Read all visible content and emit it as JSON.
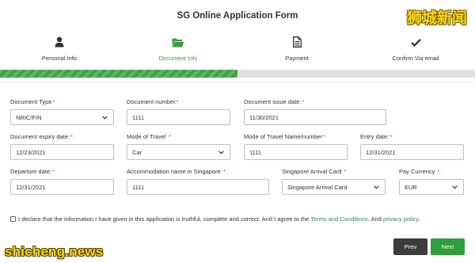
{
  "form": {
    "title": "SG Online Application Form"
  },
  "watermarks": {
    "top": "狮城新闻",
    "bottom": "shicheng.news"
  },
  "steps": [
    {
      "label": "Personal Info",
      "icon": "user-icon",
      "active": false
    },
    {
      "label": "Document Info",
      "icon": "folder-open-icon",
      "active": true
    },
    {
      "label": "Payment",
      "icon": "document-icon",
      "active": false
    },
    {
      "label": "Confirm Via email",
      "icon": "check-icon",
      "active": false
    }
  ],
  "progress": {
    "fraction": 0.5,
    "color": "#3aa447"
  },
  "fields": {
    "document_type": {
      "label": "Document Type",
      "value": "NRIC/FIN"
    },
    "document_number": {
      "label": "Document number",
      "value": "1111"
    },
    "document_issue_date": {
      "label": "Document issue date:",
      "value": "11/30/2021"
    },
    "document_expiry_date": {
      "label": "Document expiry date:",
      "value": "12/23/2021"
    },
    "mode_of_travel": {
      "label": "Mode of Travel",
      "value": "Car"
    },
    "mode_of_travel_name": {
      "label": "Mode of Travel Name/number",
      "value": "1111"
    },
    "entry_date": {
      "label": "Entry date:",
      "value": "12/31/2021"
    },
    "departure_date": {
      "label": "Departure date:",
      "value": "12/31/2021"
    },
    "accommodation": {
      "label": "Accommodation name in Singapore",
      "value": "1111"
    },
    "arrival_card": {
      "label": "Singapore Arrival Card",
      "value": "Singapore Arrival Card"
    },
    "pay_currency": {
      "label": "Pay Currency",
      "value": "EUR"
    }
  },
  "declaration": {
    "text_before": "I declare that the information I have given in this application is truthful, complete and correct. And I agree to the",
    "terms_link": "Terms and Conditions",
    "text_middle": ". And",
    "privacy_link": "privacy policy",
    "text_after": "."
  },
  "buttons": {
    "prev": "Prev",
    "next": "Next"
  },
  "colors": {
    "accent": "#3aa447",
    "required": "#e0342e",
    "prev_bg": "#3c3c3c",
    "next_bg": "#2f9e3c"
  }
}
